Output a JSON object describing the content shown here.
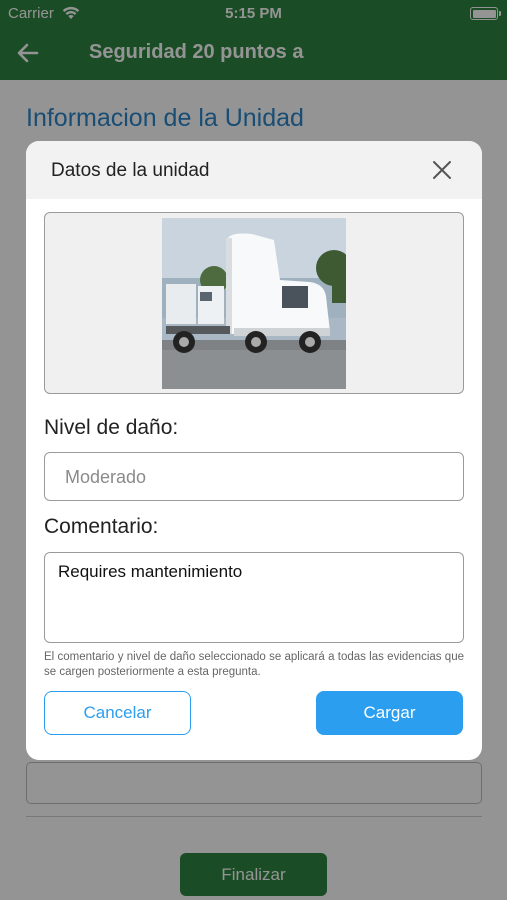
{
  "status_bar": {
    "carrier": "Carrier",
    "time": "5:15 PM"
  },
  "nav_bar": {
    "title": "Seguridad 20 puntos a",
    "back_icon": "back-arrow-icon"
  },
  "screen": {
    "section_title": "Informacion de la Unidad",
    "finish_label": "Finalizar"
  },
  "modal": {
    "title": "Datos de la unidad",
    "close_icon": "close-icon",
    "photo": "truck-photo",
    "damage_label": "Nivel de daño:",
    "damage_placeholder": "Moderado",
    "comment_label": "Comentario:",
    "comment_value": "Requires mantenimiento",
    "hint": "El comentario y nivel de daño seleccionado se aplicará a todas las evidencias que se cargen posteriormente a esta pregunta.",
    "cancel_label": "Cancelar",
    "upload_label": "Cargar"
  },
  "colors": {
    "header_green": "#2e8540",
    "accent_blue": "#2b9ef0",
    "section_title_blue": "#2b86c9"
  }
}
